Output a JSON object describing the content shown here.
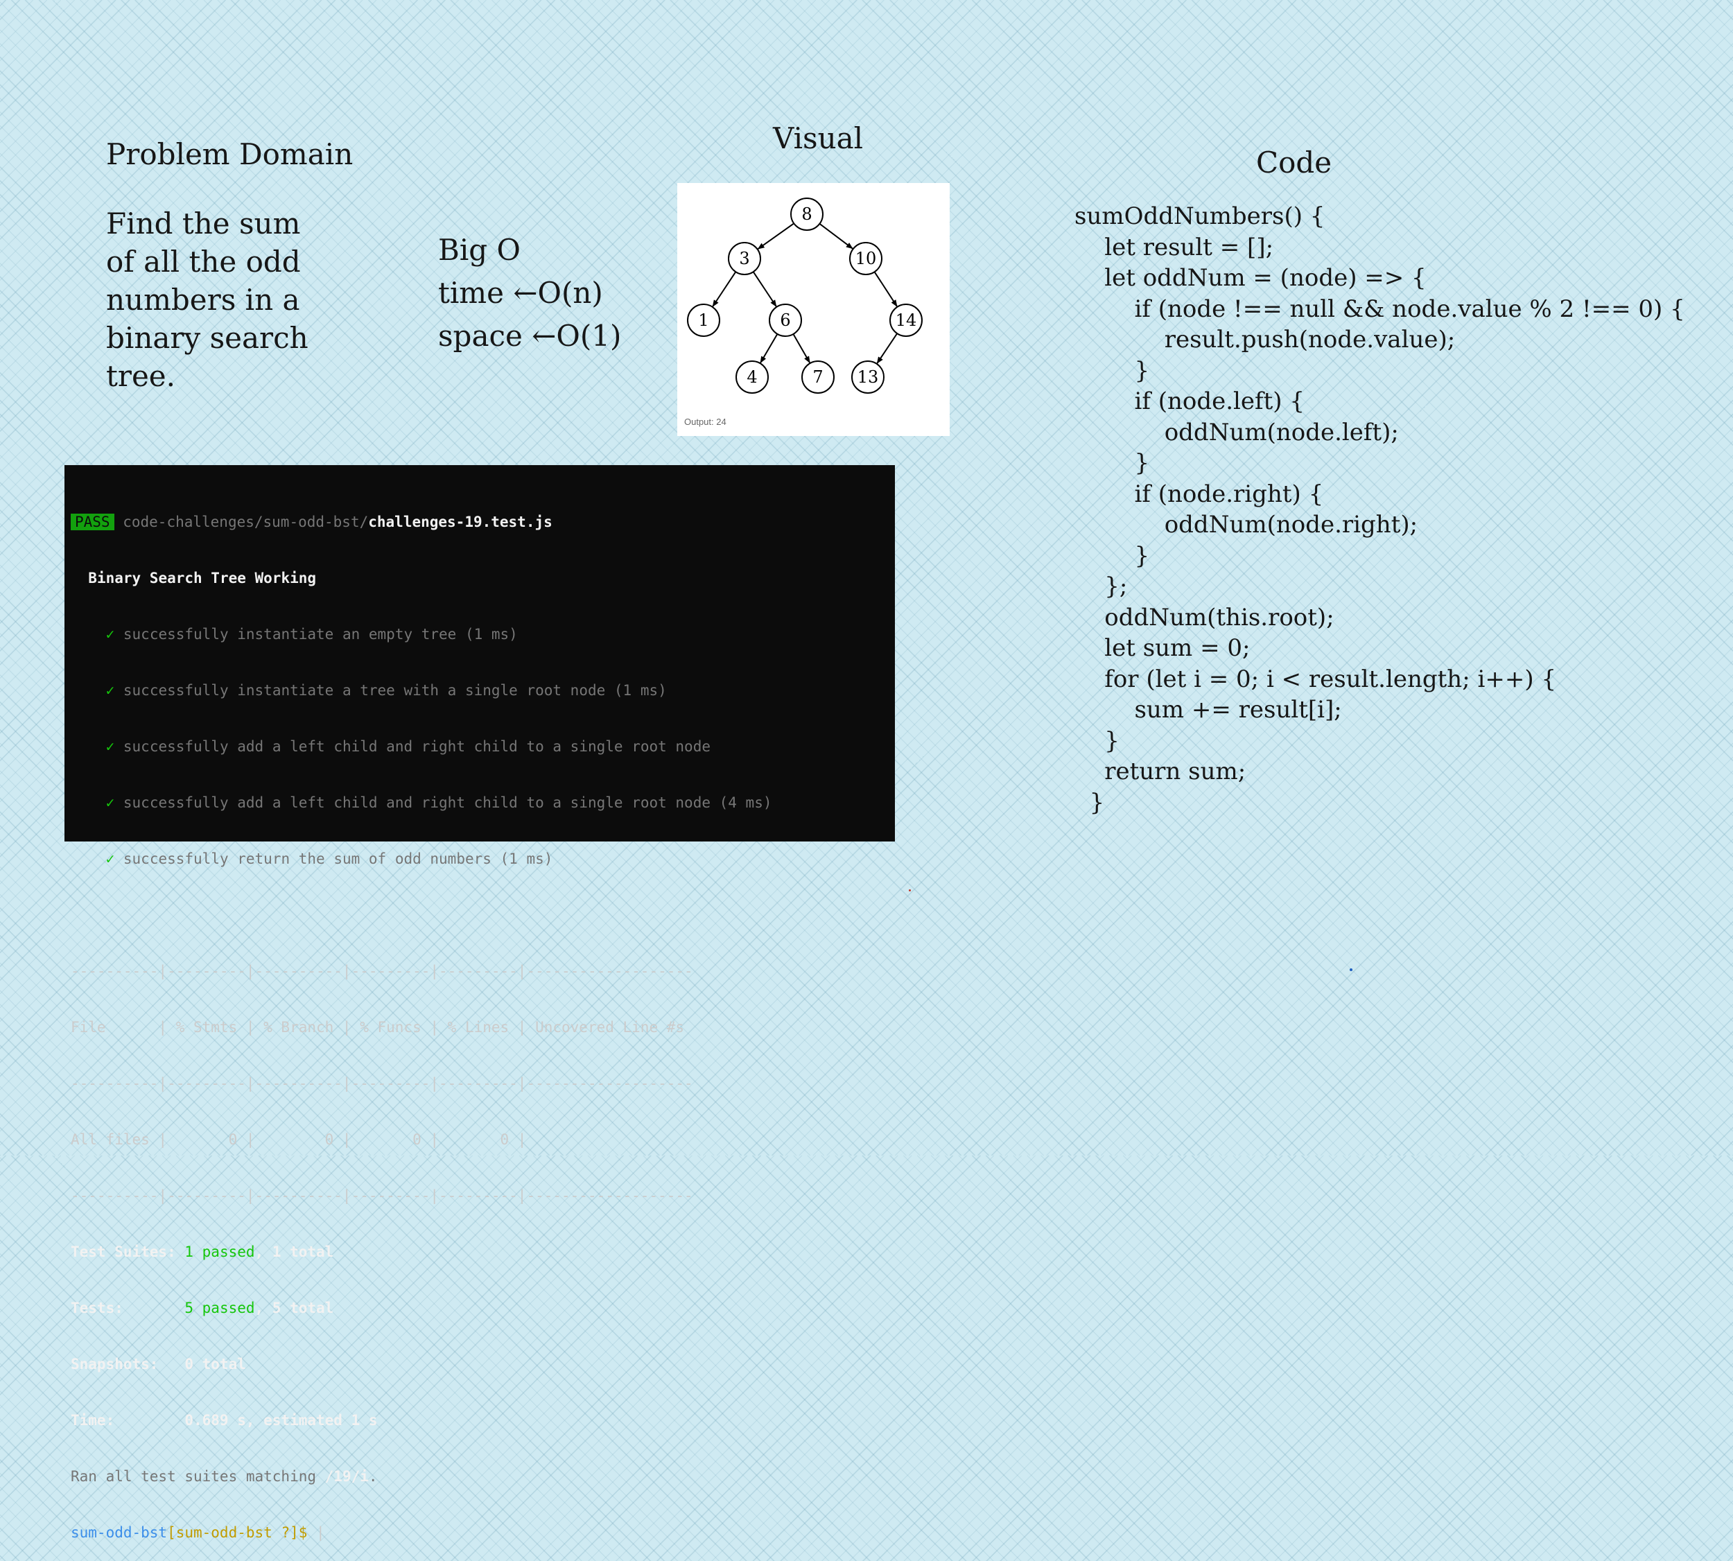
{
  "problem": {
    "heading": "Problem Domain",
    "text": [
      "Find the sum",
      "of all the odd",
      "numbers in a",
      "binary search",
      "tree."
    ]
  },
  "bigo": {
    "heading": "Big O",
    "time": "time ←O(n)",
    "space": "space ←O(1)"
  },
  "visual": {
    "heading": "Visual",
    "nodes": [
      "8",
      "3",
      "10",
      "1",
      "6",
      "14",
      "4",
      "7",
      "13"
    ],
    "output": "Output: 24"
  },
  "code": {
    "heading": "Code",
    "lines": [
      "sumOddNumbers() {",
      "    let result = [];",
      "    let oddNum = (node) => {",
      "        if (node !== null && node.value % 2 !== 0) {",
      "            result.push(node.value);",
      "        }",
      "        if (node.left) {",
      "            oddNum(node.left);",
      "        }",
      "        if (node.right) {",
      "            oddNum(node.right);",
      "        }",
      "    };",
      "    oddNum(this.root);",
      "    let sum = 0;",
      "    for (let i = 0; i < result.length; i++) {",
      "        sum += result[i];",
      "    }",
      "    return sum;",
      "  }"
    ]
  },
  "terminal": {
    "pass_badge": "PASS",
    "test_path": "code-challenges/sum-odd-bst/",
    "test_file": "challenges-19.test.js",
    "suite_name": "Binary Search Tree Working",
    "tests": [
      "successfully instantiate an empty tree (1 ms)",
      "successfully instantiate a tree with a single root node (1 ms)",
      "successfully add a left child and right child to a single root node",
      "successfully add a left child and right child to a single root node (4 ms)",
      "successfully return the sum of odd numbers (1 ms)"
    ],
    "check": "✓",
    "coverage_sep": "----------|---------|----------|---------|---------|-------------------",
    "coverage_header": "File      | % Stmts | % Branch | % Funcs | % Lines | Uncovered Line #s",
    "coverage_row": "All files |       0 |        0 |       0 |       0 |",
    "suites_label": "Test Suites: ",
    "suites_passed": "1 passed",
    "suites_total": ", 1 total",
    "tests_label": "Tests:       ",
    "tests_passed": "5 passed",
    "tests_total": ", 5 total",
    "snapshots": "Snapshots:   0 total",
    "time": "Time:        0.689 s, estimated 1 s",
    "ran_prefix": "Ran all test suites matching ",
    "ran_pattern": "/19/i",
    "ran_suffix": ".",
    "prompt_dir": "sum-odd-bst",
    "prompt_branch": "[sum-odd-bst ?]$ ",
    "cursor": "|"
  }
}
